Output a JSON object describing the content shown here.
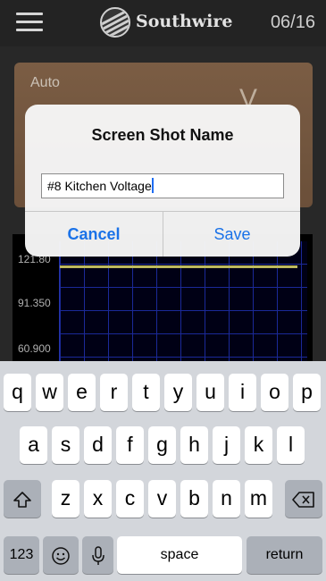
{
  "header": {
    "brand": "Southwire",
    "page_indicator": "06/16"
  },
  "meter": {
    "mode": "Auto",
    "unit": "V"
  },
  "graph": {
    "y_ticks": [
      "121.80",
      "91.350",
      "60.900"
    ]
  },
  "dialog": {
    "title": "Screen Shot Name",
    "input_value": "#8 Kitchen Voltage",
    "cancel_label": "Cancel",
    "save_label": "Save"
  },
  "keyboard": {
    "row1": [
      "q",
      "w",
      "e",
      "r",
      "t",
      "y",
      "u",
      "i",
      "o",
      "p"
    ],
    "row2": [
      "a",
      "s",
      "d",
      "f",
      "g",
      "h",
      "j",
      "k",
      "l"
    ],
    "row3": [
      "z",
      "x",
      "c",
      "v",
      "b",
      "n",
      "m"
    ],
    "numbers_label": "123",
    "space_label": "space",
    "return_label": "return",
    "icons": {
      "shift": "shift-icon",
      "backspace": "backspace-icon",
      "emoji": "emoji-icon",
      "dictation": "microphone-icon"
    }
  }
}
